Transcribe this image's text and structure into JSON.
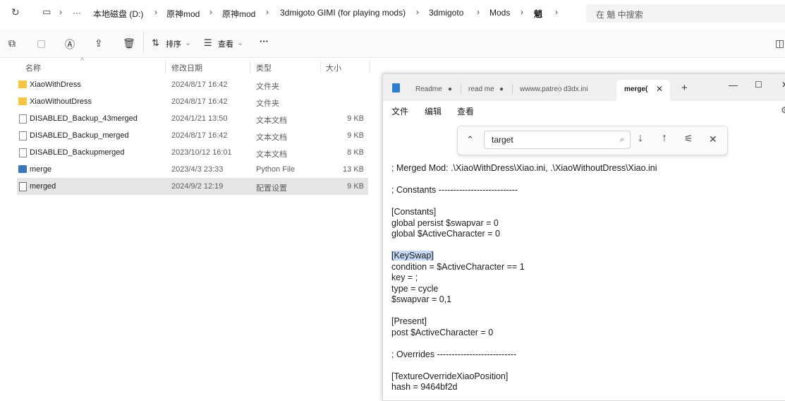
{
  "address": {
    "crumbs": [
      "本地磁盘 (D:)",
      "原神mod",
      "原神mod",
      "3dmigoto GIMI (for playing mods)",
      "3dmigoto",
      "Mods",
      "魈"
    ],
    "ellipsis": "···",
    "search_placeholder": "在 魈 中搜索"
  },
  "toolbar": {
    "sort_label": "排序",
    "view_label": "查看",
    "more": "···"
  },
  "columns": {
    "name": "名称",
    "date": "修改日期",
    "type": "类型",
    "size": "大小"
  },
  "files": [
    {
      "name": "XiaoWithDress",
      "date": "2024/8/17 16:42",
      "type": "文件夹",
      "size": "",
      "icon": "folder-icon"
    },
    {
      "name": "XiaoWithoutDress",
      "date": "2024/8/17 16:42",
      "type": "文件夹",
      "size": "",
      "icon": "folder-icon"
    },
    {
      "name": "DISABLED_Backup_43merged",
      "date": "2024/1/21 13:50",
      "type": "文本文档",
      "size": "9 KB",
      "icon": "text-file-icon"
    },
    {
      "name": "DISABLED_Backup_merged",
      "date": "2024/8/17 16:42",
      "type": "文本文档",
      "size": "9 KB",
      "icon": "text-file-icon"
    },
    {
      "name": "DISABLED_Backupmerged",
      "date": "2023/10/12 16:01",
      "type": "文本文档",
      "size": "8 KB",
      "icon": "text-file-icon"
    },
    {
      "name": "merge",
      "date": "2023/4/3 23:33",
      "type": "Python File",
      "size": "13 KB",
      "icon": "python-file-icon"
    },
    {
      "name": "merged",
      "date": "2024/9/2 12:19",
      "type": "配置设置",
      "size": "9 KB",
      "icon": "config-file-icon"
    }
  ],
  "notepad": {
    "tabs": [
      "Readme",
      "read me",
      "wwww.patreo",
      "d3dx.ini",
      "merge("
    ],
    "menu": [
      "文件",
      "编辑",
      "查看"
    ],
    "find_value": "target",
    "lines": [
      "; Merged Mod: .\\XiaoWithDress\\Xiao.ini, .\\XiaoWithoutDress\\Xiao.ini",
      "",
      "; Constants ---------------------------",
      "",
      "[Constants]",
      "global persist $swapvar = 0",
      "global $ActiveCharacter = 0",
      "",
      "[KeySwap]",
      "condition = $ActiveCharacter == 1",
      "key = ;",
      "type = cycle",
      "$swapvar = 0,1",
      "",
      "[Present]",
      "post $ActiveCharacter = 0",
      "",
      "; Overrides ---------------------------",
      "",
      "[TextureOverrideXiaoPosition]",
      "hash = 9464bf2d"
    ]
  }
}
